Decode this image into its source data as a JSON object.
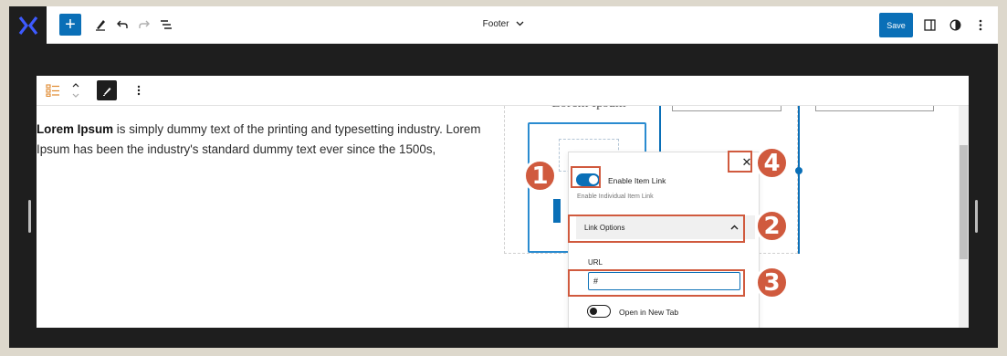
{
  "topbar": {
    "save_label": "Save",
    "document_title": "Footer",
    "icons": [
      "logo-icon",
      "plus-icon",
      "pen-icon",
      "undo-icon",
      "redo-icon",
      "list-view-icon",
      "chevron-down-icon",
      "sidebar-icon",
      "contrast-icon",
      "more-vertical-icon"
    ]
  },
  "block_toolbar": {
    "icons": [
      "list-block-icon",
      "move-up-down-icon",
      "edit-icon",
      "more-vertical-icon"
    ]
  },
  "content": {
    "para_bold": "Lorem Ipsum",
    "para_rest": " is simply dummy text of the printing and typesetting industry. Lorem Ipsum has been the industry's standard dummy text ever since the 1500s,",
    "card_title": "Lorem Ipsum"
  },
  "popover": {
    "enable_link_label": "Enable Item Link",
    "enable_link_help": "Enable Individual Item Link",
    "enable_link_on": true,
    "link_options_label": "Link Options",
    "url_label": "URL",
    "url_value": "#",
    "new_tab_label": "Open in New Tab",
    "new_tab_on": false
  },
  "annotations": [
    "1",
    "2",
    "3",
    "4"
  ],
  "colors": {
    "accent": "#0a6fb7",
    "annotation": "#d05a3e",
    "frame": "#1e1e1e",
    "outer": "#ddd8cc"
  }
}
